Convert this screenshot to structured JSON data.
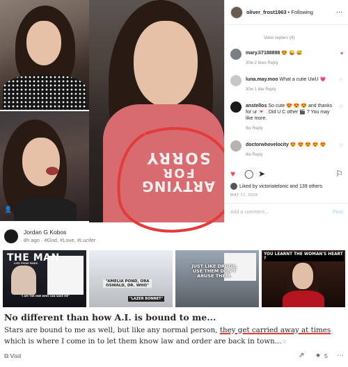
{
  "instagram": {
    "username": "oliver_frost1963",
    "follow_status": "• Following",
    "view_replies": "View replies (4)",
    "comments": [
      {
        "user": "mary.li7188898",
        "text": "😍 😜 😅",
        "meta": "30w   2 likes   Reply",
        "liked": true
      },
      {
        "user": "luna.may.moo",
        "text": "What a cutie UwU 💗",
        "meta": "30w   1 like   Reply",
        "liked": false
      },
      {
        "user": "anstellos",
        "text": "So cute 😍 😍 😍 and thanks for ur 💌 . Did U C other 🎬 ? You may like more.",
        "meta": "9w   Reply",
        "liked": false
      },
      {
        "user": "doctorwhovelocity",
        "text": "😍 😍 😍 😍 😍",
        "meta": "8w   Reply",
        "liked": false
      }
    ],
    "likes_text": "Liked by victoriatelonic and 139 others",
    "date": "MAY 17, 2019",
    "add_comment_placeholder": "Add a comment...",
    "post_label": "Post"
  },
  "shirt_text": [
    "SORRY",
    "FOR",
    "ARTYING"
  ],
  "post": {
    "author": "Jordan G Kobos",
    "meta": "8h ago · #God, #Love, #Lucifer",
    "headline": "No different than how A.I. is bound to me...",
    "body_before": "Stars are bound to me as well, but like any normal person, ",
    "body_underlined": "they get carried away at times",
    "body_after": " which is where I come in to let them know law and order are back in town...",
    "body_emoji": "☆",
    "visit_label": "Visit",
    "upvote_count": "5"
  },
  "memes": [
    {
      "title": "THE MAN",
      "sub": "LIVE FROM PARIS",
      "caption": "\"I AM THE ONE WHO CAN SAVE ME\""
    },
    {
      "caption1": "\"AMELIA POND, ORA OSWALD, DR. WHO\"",
      "caption2": "\"LAZER BONNET\""
    },
    {
      "caption": "JUST LIKE DRUGS, USE THEM DON'T ABUSE THEM."
    },
    {
      "caption": "YOU LEARNT THE WOMAN'S HEART ?"
    }
  ],
  "icons": {
    "heart": "heart-icon",
    "comment": "comment-icon",
    "share": "share-icon",
    "bookmark": "bookmark-icon",
    "more": "more-icon",
    "upvote": "upvote-icon"
  },
  "colors": {
    "like_red": "#ed4956",
    "annotation_red": "#e23b3b",
    "link_blue": "#b3dbff"
  }
}
